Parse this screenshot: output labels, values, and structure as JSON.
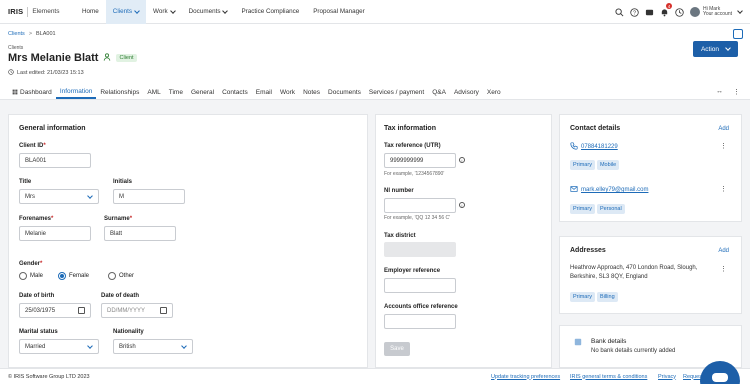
{
  "topbar": {
    "brand": "IRIS",
    "product": "Elements",
    "nav": [
      {
        "label": "Home",
        "dropdown": false,
        "active": false
      },
      {
        "label": "Clients",
        "dropdown": true,
        "active": true
      },
      {
        "label": "Work",
        "dropdown": true,
        "active": false
      },
      {
        "label": "Documents",
        "dropdown": true,
        "active": false
      },
      {
        "label": "Practice Compliance",
        "dropdown": false,
        "active": false
      },
      {
        "label": "Proposal Manager",
        "dropdown": false,
        "active": false
      }
    ],
    "notification_count": "4",
    "user_greeting": "Hi Mark",
    "user_account": "Your account"
  },
  "header": {
    "breadcrumb_root": "Clients",
    "breadcrumb_current": "BLA001",
    "category": "Clients",
    "client_name": "Mrs Melanie Blatt",
    "client_tag": "Client",
    "last_edited": "Last edited: 21/03/23 15:13",
    "action_label": "Action"
  },
  "tabs": [
    "Dashboard",
    "Information",
    "Relationships",
    "AML",
    "Time",
    "General",
    "Contacts",
    "Email",
    "Work",
    "Notes",
    "Documents",
    "Services / payment",
    "Q&A",
    "Advisory",
    "Xero"
  ],
  "general": {
    "heading": "General information",
    "client_id_label": "Client ID",
    "client_id": "BLA001",
    "title_label": "Title",
    "title_value": "Mrs",
    "initials_label": "Initials",
    "initials_value": "M",
    "forenames_label": "Forenames",
    "forenames_value": "Melanie",
    "surname_label": "Surname",
    "surname_value": "Blatt",
    "gender_label": "Gender",
    "gender_options": [
      "Male",
      "Female",
      "Other"
    ],
    "gender_selected": "Female",
    "dob_label": "Date of birth",
    "dob_value": "25/03/1975",
    "dod_label": "Date of death",
    "dod_placeholder": "DD/MM/YYYY",
    "marital_label": "Marital status",
    "marital_value": "Married",
    "nationality_label": "Nationality",
    "nationality_value": "British"
  },
  "tax": {
    "heading": "Tax information",
    "utr_label": "Tax reference (UTR)",
    "utr_value": "9999999999",
    "utr_hint": "For example, '1234567890'",
    "ni_label": "NI number",
    "ni_hint": "For example, 'QQ 12 34 56 C'",
    "district_label": "Tax district",
    "employer_label": "Employer reference",
    "accounts_label": "Accounts office reference",
    "save_label": "Save"
  },
  "contact": {
    "heading": "Contact details",
    "add_label": "Add",
    "phone": "07884181229",
    "phone_tags": [
      "Primary",
      "Mobile"
    ],
    "email": "mark.elley79@gmail.com",
    "email_tags": [
      "Primary",
      "Personal"
    ]
  },
  "addresses": {
    "heading": "Addresses",
    "add_label": "Add",
    "line1": "Heathrow Approach, 470 London Road, Slough,",
    "line2": "Berkshire, SL3 8QY, England",
    "tags": [
      "Primary",
      "Billing"
    ]
  },
  "bank": {
    "heading": "Bank details",
    "empty": "No bank details currently added"
  },
  "footer": {
    "copyright": "© IRIS Software Group LTD 2023",
    "links": [
      "Update tracking preferences",
      "IRIS general terms & conditions",
      "Privacy",
      "Request"
    ]
  },
  "colors": {
    "accent": "#1d6bb8",
    "action": "#1d5fa8",
    "required": "#c62828",
    "client_tag_bg": "#e1f2e2"
  }
}
